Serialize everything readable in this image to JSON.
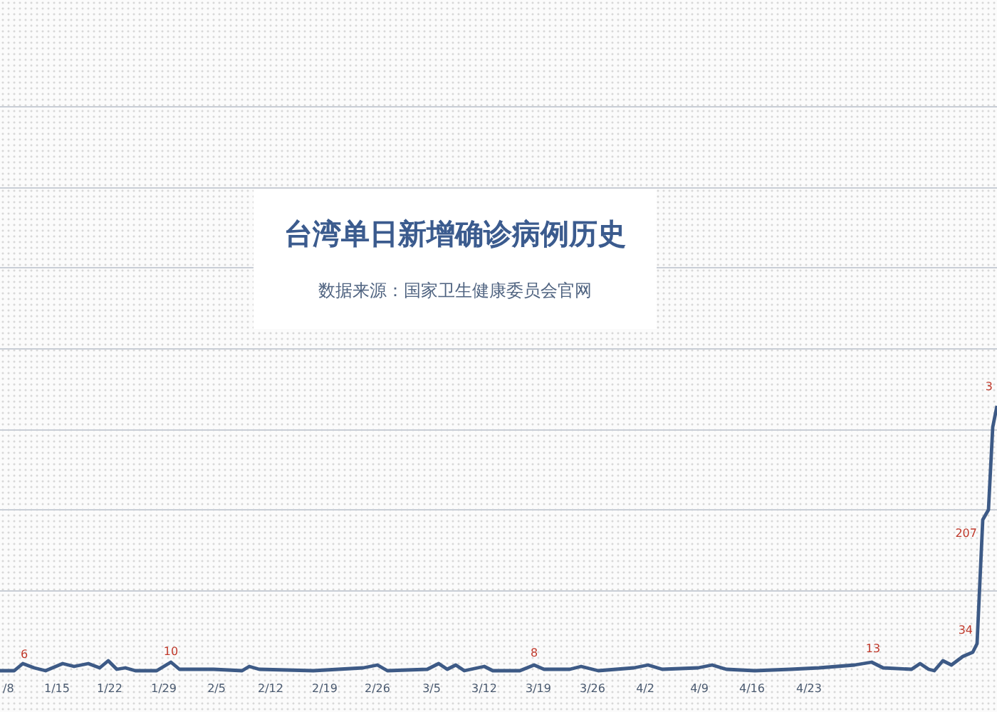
{
  "title_card": {
    "title": "台湾单日新增确诊病例历史",
    "source": "数据来源：国家卫生健康委员会官网"
  },
  "chart": {
    "x_labels": [
      "/8",
      "1/15",
      "1/22",
      "1/29",
      "2/5",
      "2/12",
      "2/19",
      "2/26",
      "3/5",
      "3/12",
      "3/19",
      "3/26",
      "4/2",
      "4/9",
      "4/16",
      "4/23"
    ],
    "point_labels": [
      "6",
      "10",
      "8",
      "13",
      "34",
      "207",
      "3"
    ]
  }
}
